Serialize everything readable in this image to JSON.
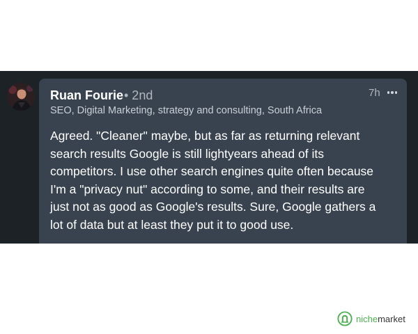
{
  "comment": {
    "author": {
      "name": "Ruan Fourie",
      "degree": "• 2nd",
      "headline": "SEO, Digital Marketing, strategy and consulting, South Africa"
    },
    "timestamp": "7h",
    "text": "Agreed. \"Cleaner\" maybe, but as far as returning relevant\nsearch results Google is still lightyears ahead of its\ncompetitors. I use other search engines quite often because\nI'm a \"privacy nut\" according to some, and their results are\njust not as good as Google's results. Sure, Google gathers a\nlot of data but at least they put it to good use.",
    "more_icon": "ellipsis-icon"
  },
  "watermark": {
    "brand_prefix": "niche",
    "brand_suffix": "market",
    "logo_icon": "nichemarket-logo-icon"
  },
  "colors": {
    "background": "#1d2226",
    "card": "#38434f",
    "text": "#ffffff",
    "muted": "#b0b7bf",
    "brand_green": "#4caf50"
  }
}
